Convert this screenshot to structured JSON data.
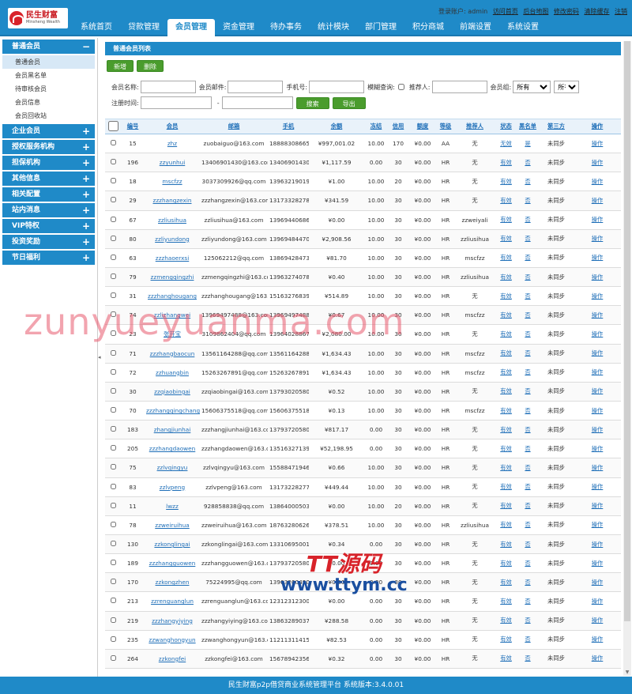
{
  "header": {
    "logo_cn": "民生财富",
    "logo_en": "Minsheng Wealth",
    "login_text": "登录账户: admin",
    "links": [
      "访问首页",
      "后台地图",
      "修改密码",
      "清除缓存",
      "注销"
    ],
    "nav": [
      "系统首页",
      "贷款管理",
      "会员管理",
      "资金管理",
      "待办事务",
      "统计模块",
      "部门管理",
      "积分商城",
      "前端设置",
      "系统设置"
    ],
    "active_nav": 2
  },
  "sidebar": {
    "open_group": "普通会员",
    "open_sign": "−",
    "items": [
      "普通会员",
      "会员黑名单",
      "待审核会员",
      "会员信息",
      "会员回收站"
    ],
    "groups": [
      "企业会员",
      "授权服务机构",
      "担保机构",
      "其他信息",
      "相关配置",
      "站内消息",
      "VIP特权",
      "投资奖励",
      "节日福利"
    ],
    "closed_sign": "+"
  },
  "panel": {
    "title": "普通会员列表"
  },
  "toolbar": {
    "add_label": "新增",
    "delete_label": "删除"
  },
  "filters": {
    "name_label": "会员名称:",
    "email_label": "会员邮件:",
    "phone_label": "手机号:",
    "fuzzy_label": "模糊查询:",
    "referrer_label": "推荐人:",
    "group_label": "会员组:",
    "group_select": "所有",
    "group_select2": "所有",
    "regtime_label": "注册时间:",
    "dash": "-",
    "search_label": "搜索",
    "export_label": "导出"
  },
  "table": {
    "headers": [
      "编号",
      "会员",
      "邮箱",
      "手机",
      "余额",
      "冻结",
      "信用",
      "额度",
      "等级",
      "推荐人",
      "状态",
      "黑名单",
      "第三方",
      "操作"
    ],
    "rows": [
      [
        "15",
        "zhz",
        "zuobaiguo@163.com",
        "18888308665",
        "¥997,001.02",
        "10.00",
        "170",
        "¥0.00",
        "AA",
        "无",
        "无效",
        "是",
        "未同步",
        "操作"
      ],
      [
        "196",
        "zzyunhui",
        "13406901430@163.com",
        "13406901430",
        "¥1,117.59",
        "0.00",
        "30",
        "¥0.00",
        "HR",
        "无",
        "有效",
        "否",
        "未同步",
        "操作"
      ],
      [
        "18",
        "mscfzz",
        "3037309926@qq.com",
        "13963219019",
        "¥1.00",
        "10.00",
        "20",
        "¥0.00",
        "HR",
        "无",
        "有效",
        "否",
        "未同步",
        "操作"
      ],
      [
        "29",
        "zzzhangzexin",
        "zzzhangzexin@163.com",
        "13173328278",
        "¥341.59",
        "10.00",
        "30",
        "¥0.00",
        "HR",
        "无",
        "有效",
        "否",
        "未同步",
        "操作"
      ],
      [
        "67",
        "zzliusihua",
        "zzliusihua@163.com",
        "13969440686",
        "¥0.00",
        "10.00",
        "30",
        "¥0.00",
        "HR",
        "zzweiyali",
        "有效",
        "否",
        "未同步",
        "操作"
      ],
      [
        "80",
        "zzliyundong",
        "zzliyundong@163.com",
        "13969484470",
        "¥2,908.56",
        "10.00",
        "30",
        "¥0.00",
        "HR",
        "zzliusihua",
        "有效",
        "否",
        "未同步",
        "操作"
      ],
      [
        "63",
        "zzzhaoerxsi",
        "125062212@qq.com",
        "13869428473",
        "¥81.70",
        "10.00",
        "30",
        "¥0.00",
        "HR",
        "mscfzz",
        "有效",
        "否",
        "未同步",
        "操作"
      ],
      [
        "79",
        "zzmengqingzhi",
        "zzmengqingzhi@163.com",
        "13963274078",
        "¥0.40",
        "10.00",
        "30",
        "¥0.00",
        "HR",
        "zzliusihua",
        "有效",
        "否",
        "未同步",
        "操作"
      ],
      [
        "31",
        "zzzhanghougang",
        "zzzhanghougang@163.com",
        "15163276839",
        "¥514.89",
        "10.00",
        "30",
        "¥0.00",
        "HR",
        "无",
        "有效",
        "否",
        "未同步",
        "操作"
      ],
      [
        "74",
        "zzlizhangwei",
        "13969497488@163.com",
        "13969497488",
        "¥0.67",
        "10.00",
        "30",
        "¥0.00",
        "HR",
        "mscfzz",
        "有效",
        "否",
        "未同步",
        "操作"
      ],
      [
        "23",
        "张开宝",
        "3109862404@qq.com",
        "13964028867",
        "¥2,080.00",
        "10.00",
        "30",
        "¥0.00",
        "HR",
        "无",
        "有效",
        "否",
        "未同步",
        "操作"
      ],
      [
        "71",
        "zzzhangbaocun",
        "13561164288@qq.com",
        "13561164288",
        "¥1,634.43",
        "10.00",
        "30",
        "¥0.00",
        "HR",
        "mscfzz",
        "有效",
        "否",
        "未同步",
        "操作"
      ],
      [
        "72",
        "zzhuangbin",
        "15263267891@qq.com",
        "15263267891",
        "¥1,634.43",
        "10.00",
        "30",
        "¥0.00",
        "HR",
        "mscfzz",
        "有效",
        "否",
        "未同步",
        "操作"
      ],
      [
        "30",
        "zzqiaobingai",
        "zzqiaobingai@163.com",
        "13793020580",
        "¥0.52",
        "10.00",
        "30",
        "¥0.00",
        "HR",
        "无",
        "有效",
        "否",
        "未同步",
        "操作"
      ],
      [
        "70",
        "zzzhangqingchang",
        "15606375518@qq.com",
        "15606375518",
        "¥0.13",
        "10.00",
        "30",
        "¥0.00",
        "HR",
        "mscfzz",
        "有效",
        "否",
        "未同步",
        "操作"
      ],
      [
        "183",
        "zhangjiunhai",
        "zzzhangjiunhai@163.com",
        "13793720580",
        "¥817.17",
        "0.00",
        "30",
        "¥0.00",
        "HR",
        "无",
        "有效",
        "否",
        "未同步",
        "操作"
      ],
      [
        "205",
        "zzzhangdaowen",
        "zzzhangdaowen@163.com",
        "13516327139",
        "¥52,198.95",
        "0.00",
        "30",
        "¥0.00",
        "HR",
        "无",
        "有效",
        "否",
        "未同步",
        "操作"
      ],
      [
        "75",
        "zzlvqingyu",
        "zzlvqingyu@163.com",
        "15588471946",
        "¥0.66",
        "10.00",
        "30",
        "¥0.00",
        "HR",
        "无",
        "有效",
        "否",
        "未同步",
        "操作"
      ],
      [
        "83",
        "zzlvpeng",
        "zzlvpeng@163.com",
        "13173228277",
        "¥449.44",
        "10.00",
        "30",
        "¥0.00",
        "HR",
        "无",
        "有效",
        "否",
        "未同步",
        "操作"
      ],
      [
        "11",
        "lwzz",
        "928858838@qq.com",
        "13864000503",
        "¥0.00",
        "10.00",
        "20",
        "¥0.00",
        "HR",
        "无",
        "有效",
        "否",
        "未同步",
        "操作"
      ],
      [
        "78",
        "zzweiruihua",
        "zzweiruihua@163.com",
        "18763280626",
        "¥378.51",
        "10.00",
        "30",
        "¥0.00",
        "HR",
        "zzliusihua",
        "有效",
        "否",
        "未同步",
        "操作"
      ],
      [
        "130",
        "zzkonglingai",
        "zzkonglingai@163.com",
        "13310695001",
        "¥0.34",
        "0.00",
        "30",
        "¥0.00",
        "HR",
        "无",
        "有效",
        "否",
        "未同步",
        "操作"
      ],
      [
        "189",
        "zzzhangguowen",
        "zzzhangguowen@163.com",
        "13793720580",
        "¥0.00",
        "0.00",
        "30",
        "¥0.00",
        "HR",
        "无",
        "有效",
        "否",
        "未同步",
        "操作"
      ],
      [
        "170",
        "zzkongzhen",
        "75224995@qq.com",
        "13963200490",
        "¥0.00",
        "0.00",
        "30",
        "¥0.00",
        "HR",
        "无",
        "有效",
        "否",
        "未同步",
        "操作"
      ],
      [
        "213",
        "zzrenguanglun",
        "zzrenguanglun@163.com",
        "12312312300",
        "¥0.00",
        "0.00",
        "30",
        "¥0.00",
        "HR",
        "无",
        "有效",
        "否",
        "未同步",
        "操作"
      ],
      [
        "219",
        "zzzhangyiying",
        "zzzhangyiying@163.com",
        "13863289037",
        "¥288.58",
        "0.00",
        "30",
        "¥0.00",
        "HR",
        "无",
        "有效",
        "否",
        "未同步",
        "操作"
      ],
      [
        "235",
        "zzwanghongyun",
        "zzwanghongyun@163.com",
        "11211311415",
        "¥82.53",
        "0.00",
        "30",
        "¥0.00",
        "HR",
        "无",
        "有效",
        "否",
        "未同步",
        "操作"
      ],
      [
        "264",
        "zzkongfei",
        "zzkongfei@163.com",
        "15678942356",
        "¥0.32",
        "0.00",
        "30",
        "¥0.00",
        "HR",
        "无",
        "有效",
        "否",
        "未同步",
        "操作"
      ]
    ]
  },
  "footer": {
    "text": "民生财富p2p借贷商业系统管理平台 系统版本:3.4.0.01"
  },
  "watermark": {
    "text1": "zunyueyuanma.com",
    "text2": "TT源码",
    "text3": "www.ttym.cc"
  },
  "colors": {
    "primary": "#1f8ac8",
    "button_green": "#4a9c2d",
    "link": "#1f6fb8"
  }
}
